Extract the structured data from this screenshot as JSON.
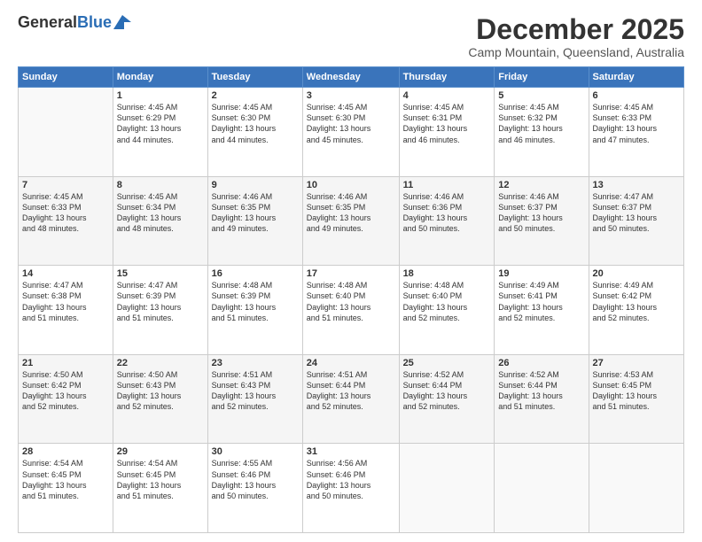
{
  "header": {
    "logo_general": "General",
    "logo_blue": "Blue",
    "title": "December 2025",
    "subtitle": "Camp Mountain, Queensland, Australia"
  },
  "calendar": {
    "headers": [
      "Sunday",
      "Monday",
      "Tuesday",
      "Wednesday",
      "Thursday",
      "Friday",
      "Saturday"
    ],
    "weeks": [
      [
        {
          "day": "",
          "info": ""
        },
        {
          "day": "1",
          "info": "Sunrise: 4:45 AM\nSunset: 6:29 PM\nDaylight: 13 hours\nand 44 minutes."
        },
        {
          "day": "2",
          "info": "Sunrise: 4:45 AM\nSunset: 6:30 PM\nDaylight: 13 hours\nand 44 minutes."
        },
        {
          "day": "3",
          "info": "Sunrise: 4:45 AM\nSunset: 6:30 PM\nDaylight: 13 hours\nand 45 minutes."
        },
        {
          "day": "4",
          "info": "Sunrise: 4:45 AM\nSunset: 6:31 PM\nDaylight: 13 hours\nand 46 minutes."
        },
        {
          "day": "5",
          "info": "Sunrise: 4:45 AM\nSunset: 6:32 PM\nDaylight: 13 hours\nand 46 minutes."
        },
        {
          "day": "6",
          "info": "Sunrise: 4:45 AM\nSunset: 6:33 PM\nDaylight: 13 hours\nand 47 minutes."
        }
      ],
      [
        {
          "day": "7",
          "info": "Sunrise: 4:45 AM\nSunset: 6:33 PM\nDaylight: 13 hours\nand 48 minutes."
        },
        {
          "day": "8",
          "info": "Sunrise: 4:45 AM\nSunset: 6:34 PM\nDaylight: 13 hours\nand 48 minutes."
        },
        {
          "day": "9",
          "info": "Sunrise: 4:46 AM\nSunset: 6:35 PM\nDaylight: 13 hours\nand 49 minutes."
        },
        {
          "day": "10",
          "info": "Sunrise: 4:46 AM\nSunset: 6:35 PM\nDaylight: 13 hours\nand 49 minutes."
        },
        {
          "day": "11",
          "info": "Sunrise: 4:46 AM\nSunset: 6:36 PM\nDaylight: 13 hours\nand 50 minutes."
        },
        {
          "day": "12",
          "info": "Sunrise: 4:46 AM\nSunset: 6:37 PM\nDaylight: 13 hours\nand 50 minutes."
        },
        {
          "day": "13",
          "info": "Sunrise: 4:47 AM\nSunset: 6:37 PM\nDaylight: 13 hours\nand 50 minutes."
        }
      ],
      [
        {
          "day": "14",
          "info": "Sunrise: 4:47 AM\nSunset: 6:38 PM\nDaylight: 13 hours\nand 51 minutes."
        },
        {
          "day": "15",
          "info": "Sunrise: 4:47 AM\nSunset: 6:39 PM\nDaylight: 13 hours\nand 51 minutes."
        },
        {
          "day": "16",
          "info": "Sunrise: 4:48 AM\nSunset: 6:39 PM\nDaylight: 13 hours\nand 51 minutes."
        },
        {
          "day": "17",
          "info": "Sunrise: 4:48 AM\nSunset: 6:40 PM\nDaylight: 13 hours\nand 51 minutes."
        },
        {
          "day": "18",
          "info": "Sunrise: 4:48 AM\nSunset: 6:40 PM\nDaylight: 13 hours\nand 52 minutes."
        },
        {
          "day": "19",
          "info": "Sunrise: 4:49 AM\nSunset: 6:41 PM\nDaylight: 13 hours\nand 52 minutes."
        },
        {
          "day": "20",
          "info": "Sunrise: 4:49 AM\nSunset: 6:42 PM\nDaylight: 13 hours\nand 52 minutes."
        }
      ],
      [
        {
          "day": "21",
          "info": "Sunrise: 4:50 AM\nSunset: 6:42 PM\nDaylight: 13 hours\nand 52 minutes."
        },
        {
          "day": "22",
          "info": "Sunrise: 4:50 AM\nSunset: 6:43 PM\nDaylight: 13 hours\nand 52 minutes."
        },
        {
          "day": "23",
          "info": "Sunrise: 4:51 AM\nSunset: 6:43 PM\nDaylight: 13 hours\nand 52 minutes."
        },
        {
          "day": "24",
          "info": "Sunrise: 4:51 AM\nSunset: 6:44 PM\nDaylight: 13 hours\nand 52 minutes."
        },
        {
          "day": "25",
          "info": "Sunrise: 4:52 AM\nSunset: 6:44 PM\nDaylight: 13 hours\nand 52 minutes."
        },
        {
          "day": "26",
          "info": "Sunrise: 4:52 AM\nSunset: 6:44 PM\nDaylight: 13 hours\nand 51 minutes."
        },
        {
          "day": "27",
          "info": "Sunrise: 4:53 AM\nSunset: 6:45 PM\nDaylight: 13 hours\nand 51 minutes."
        }
      ],
      [
        {
          "day": "28",
          "info": "Sunrise: 4:54 AM\nSunset: 6:45 PM\nDaylight: 13 hours\nand 51 minutes."
        },
        {
          "day": "29",
          "info": "Sunrise: 4:54 AM\nSunset: 6:45 PM\nDaylight: 13 hours\nand 51 minutes."
        },
        {
          "day": "30",
          "info": "Sunrise: 4:55 AM\nSunset: 6:46 PM\nDaylight: 13 hours\nand 50 minutes."
        },
        {
          "day": "31",
          "info": "Sunrise: 4:56 AM\nSunset: 6:46 PM\nDaylight: 13 hours\nand 50 minutes."
        },
        {
          "day": "",
          "info": ""
        },
        {
          "day": "",
          "info": ""
        },
        {
          "day": "",
          "info": ""
        }
      ]
    ]
  }
}
